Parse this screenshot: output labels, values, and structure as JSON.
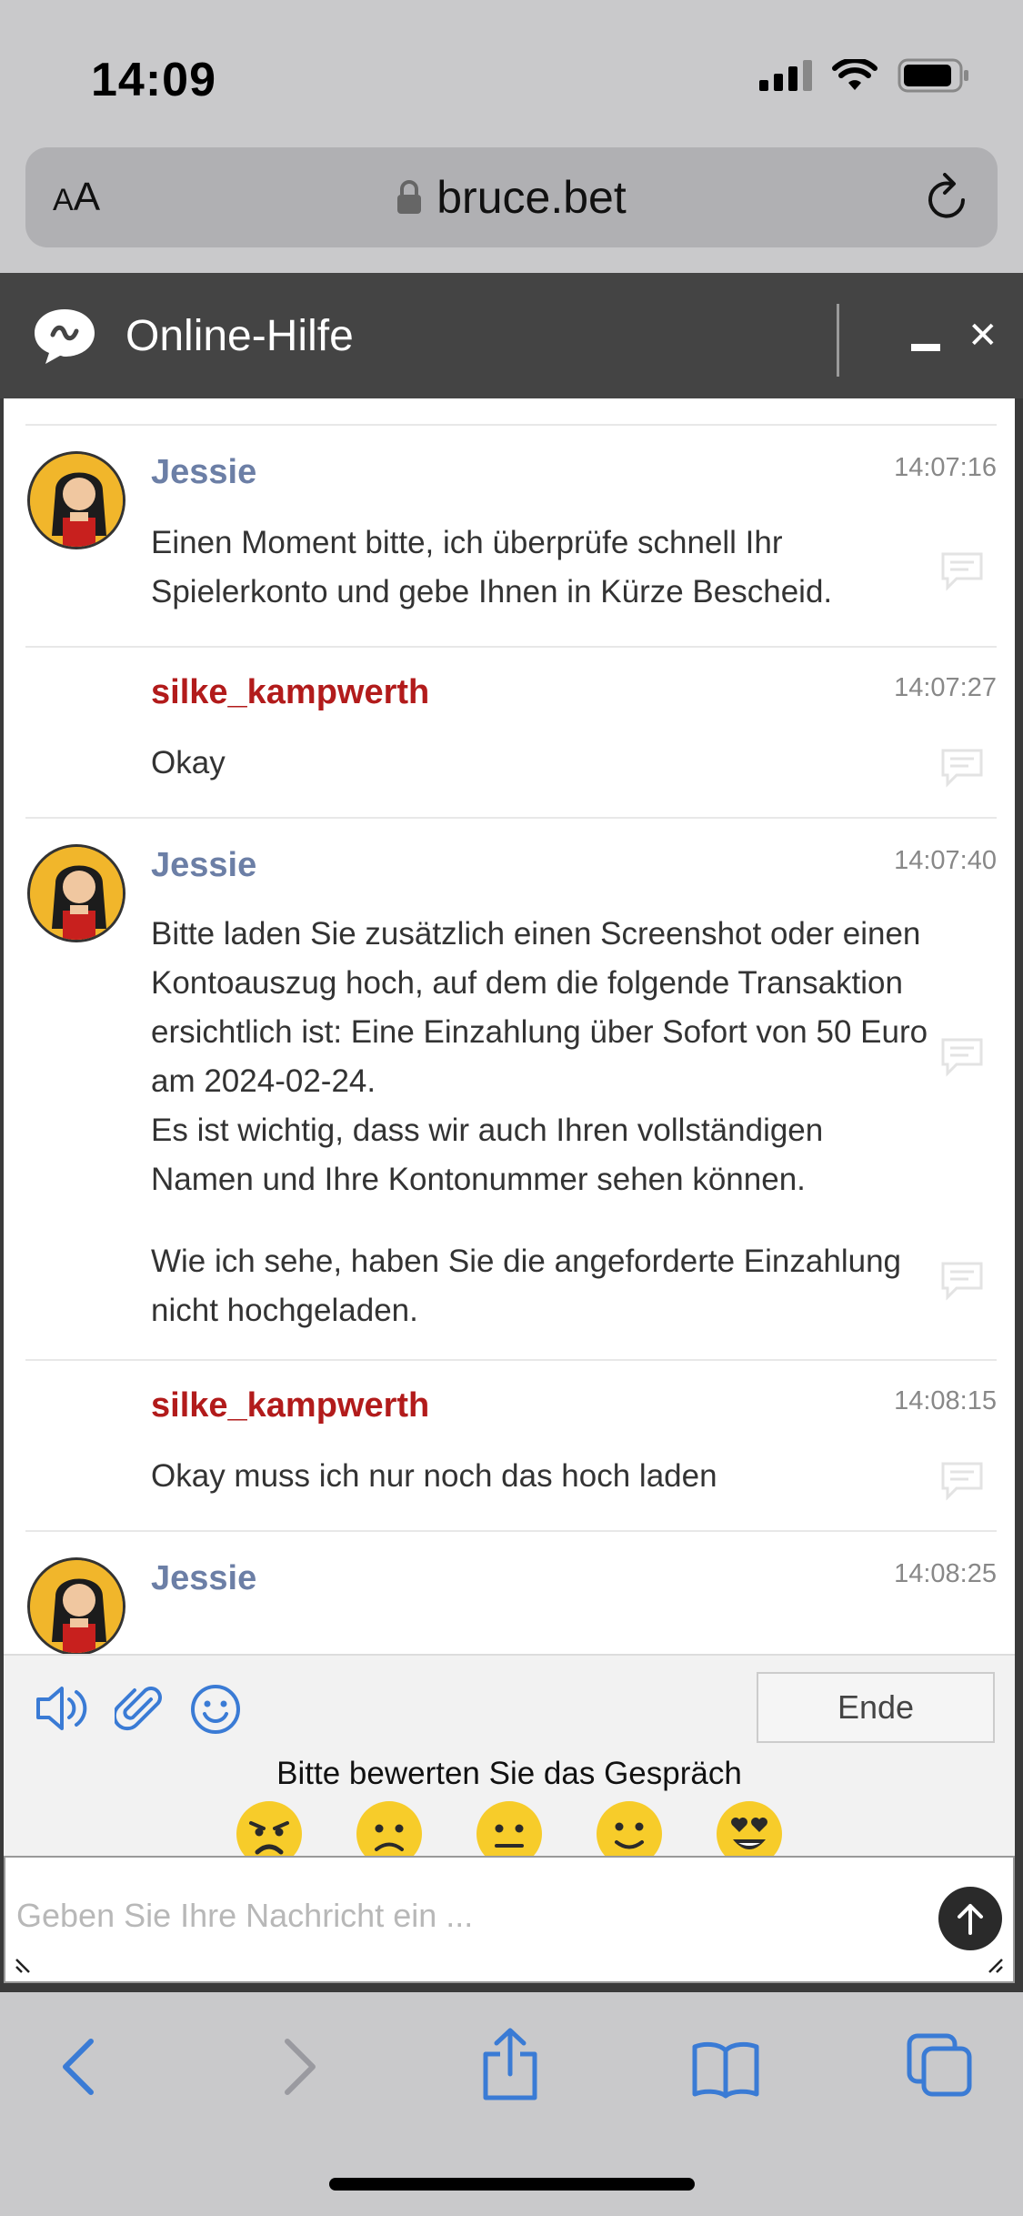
{
  "status": {
    "time": "14:09"
  },
  "browser": {
    "aa_small": "A",
    "aa_big": "A",
    "url": "bruce.bet"
  },
  "chat": {
    "title": "Online-Hilfe",
    "messages": [
      {
        "author": "Jessie",
        "role": "agent",
        "time": "14:07:16",
        "paragraphs": [
          "Einen Moment bitte, ich überprüfe schnell Ihr Spielerkonto und gebe Ihnen in Kürze Bescheid."
        ]
      },
      {
        "author": "silke_kampwerth",
        "role": "user",
        "time": "14:07:27",
        "paragraphs": [
          "Okay"
        ]
      },
      {
        "author": "Jessie",
        "role": "agent",
        "time": "14:07:40",
        "paragraphs": [
          "Bitte laden Sie zusätzlich einen Screenshot oder einen Kontoauszug hoch, auf dem die folgende Transaktion ersichtlich ist: Eine Einzahlung über Sofort von 50 Euro am 2024-02-24.",
          "Es ist wichtig, dass wir auch Ihren vollständigen Namen und Ihre Kontonummer sehen können.",
          "Wie ich sehe, haben Sie die angeforderte Einzahlung nicht hochgeladen."
        ]
      },
      {
        "author": "silke_kampwerth",
        "role": "user",
        "time": "14:08:15",
        "paragraphs": [
          "Okay muss ich nur noch das hoch laden"
        ]
      },
      {
        "author": "Jessie",
        "role": "agent",
        "time": "14:08:25",
        "paragraphs": []
      }
    ],
    "end_button": "Ende",
    "rating_label": "Bitte bewerten Sie das Gespräch",
    "rating_options": [
      "angry-emoji",
      "sad-emoji",
      "neutral-emoji",
      "smile-emoji",
      "love-emoji"
    ],
    "input_placeholder": "Geben Sie Ihre Nachricht ein ..."
  },
  "colors": {
    "agent": "#6c7fa6",
    "user": "#b21b1b",
    "accent": "#3a7bd5",
    "header": "#444444"
  }
}
